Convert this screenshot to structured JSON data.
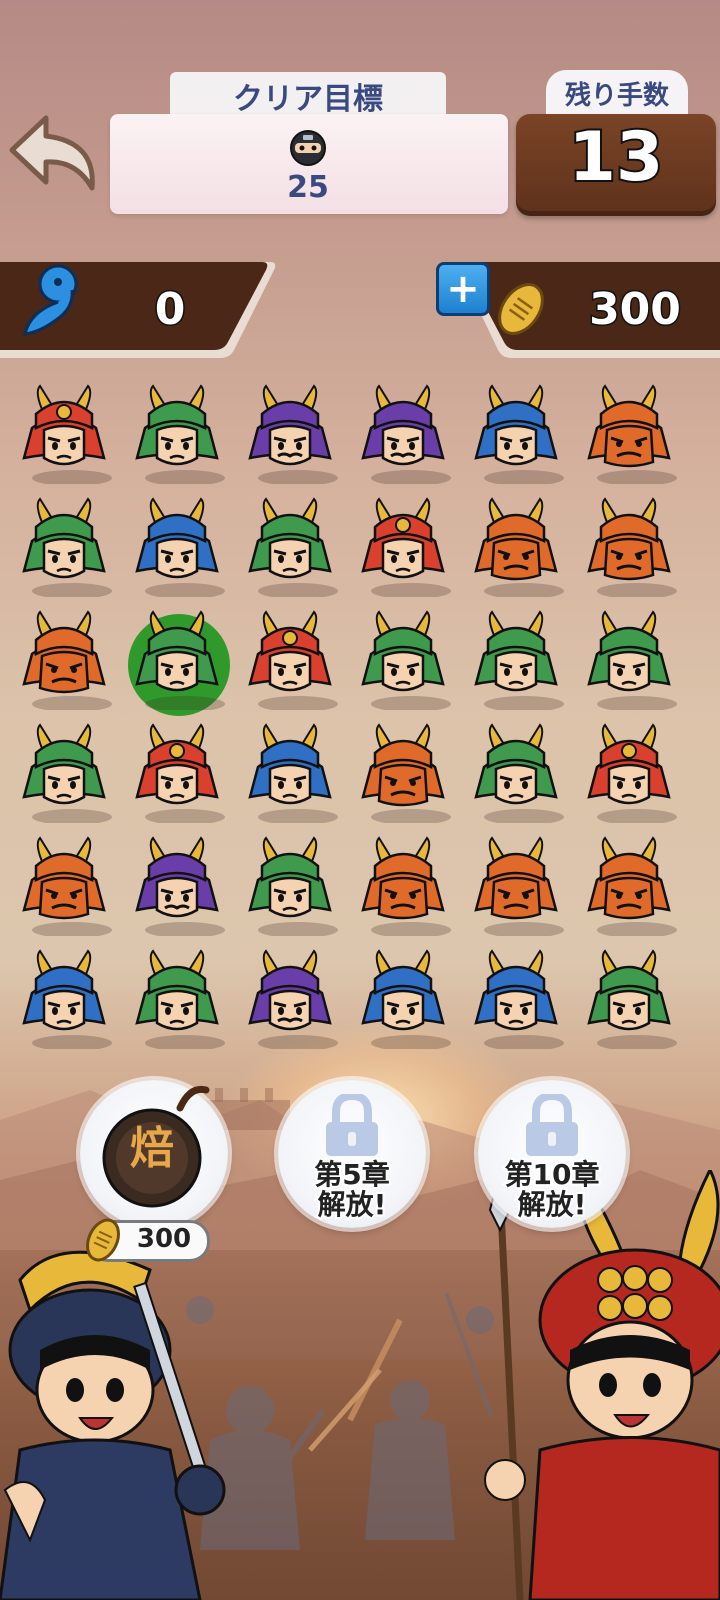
{
  "header": {
    "goal_title": "クリア目標",
    "goal_target_icon": "ninja-icon",
    "goal_count": "25",
    "moves_label": "残り手数",
    "moves_count": "13"
  },
  "resources": {
    "magatama_icon": "magatama-icon",
    "magatama_value": "0",
    "plus_label": "+",
    "coin_icon": "koban-coin-icon",
    "coin_value": "300"
  },
  "board": {
    "rows": 6,
    "cols": 6,
    "selected": [
      2,
      1
    ],
    "tiles": [
      [
        "red",
        "green",
        "purple",
        "purple",
        "blue",
        "oni"
      ],
      [
        "green",
        "blue",
        "green",
        "red",
        "oni",
        "oni"
      ],
      [
        "oni",
        "green",
        "red",
        "green",
        "green",
        "green"
      ],
      [
        "green",
        "red",
        "blue",
        "oni",
        "green",
        "red"
      ],
      [
        "oni",
        "purple",
        "green",
        "oni",
        "oni",
        "oni"
      ],
      [
        "blue",
        "green",
        "purple",
        "blue",
        "blue",
        "green"
      ]
    ]
  },
  "boosters": [
    {
      "id": "bomb",
      "kanji": "焙",
      "price": "300",
      "locked": false
    },
    {
      "id": "locked-5",
      "line1": "第5章",
      "line2": "解放!",
      "locked": true
    },
    {
      "id": "locked-10",
      "line1": "第10章",
      "line2": "解放!",
      "locked": true
    }
  ],
  "colors": {
    "red": "#d9412e",
    "green": "#3f9a4e",
    "purple": "#6a3ea8",
    "blue": "#2f6fc4",
    "oni": "#e06a2a",
    "gold": "#e8b83a",
    "moves_panel": "#6a3a20",
    "goal_text": "#3a4a80"
  }
}
